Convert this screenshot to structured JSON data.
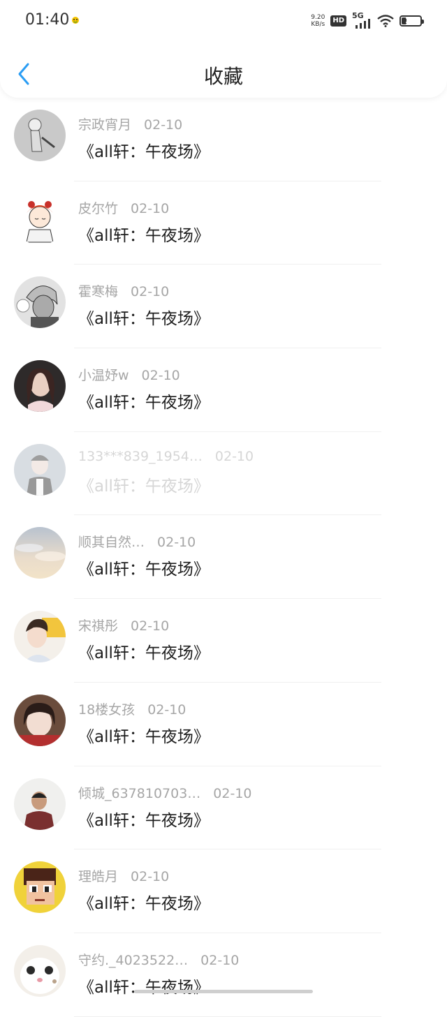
{
  "status_bar": {
    "time": "01:40",
    "speed_value": "9.20",
    "speed_unit": "KB/s",
    "hd": "HD",
    "network": "5G",
    "battery": "28",
    "battery_level": 0.28
  },
  "header": {
    "title": "收藏"
  },
  "items": [
    {
      "user": "宗政宵月",
      "date": "02-10",
      "title": "《all轩：午夜场》",
      "avatar": "sketch-figure-avatar"
    },
    {
      "user": "皮尔竹",
      "date": "02-10",
      "title": "《all轩：午夜场》",
      "avatar": "cartoon-girl-avatar"
    },
    {
      "user": "霍寒梅",
      "date": "02-10",
      "title": "《all轩：午夜场》",
      "avatar": "manga-character-avatar"
    },
    {
      "user": "小温妤w",
      "date": "02-10",
      "title": "《all轩：午夜场》",
      "avatar": "girl-photo-avatar"
    },
    {
      "user": "133***839_1954…",
      "date": "02-10",
      "title": "《all轩：午夜场》",
      "avatar": "boy-photo-avatar"
    },
    {
      "user": "顺其自然…",
      "date": "02-10",
      "title": "《all轩：午夜场》",
      "avatar": "sky-clouds-avatar"
    },
    {
      "user": "宋祺彤",
      "date": "02-10",
      "title": "《all轩：午夜场》",
      "avatar": "boy-portrait-avatar"
    },
    {
      "user": "18楼女孩",
      "date": "02-10",
      "title": "《all轩：午夜场》",
      "avatar": "girl-selfie-avatar"
    },
    {
      "user": "倾城_637810703…",
      "date": "02-10",
      "title": "《all轩：午夜场》",
      "avatar": "person-photo-avatar"
    },
    {
      "user": "理皓月",
      "date": "02-10",
      "title": "《all轩：午夜场》",
      "avatar": "pixel-character-avatar"
    },
    {
      "user": "守约._4023522…",
      "date": "02-10",
      "title": "《all轩：午夜场》",
      "avatar": "cat-face-avatar"
    }
  ],
  "colors": {
    "accent": "#2a9df4",
    "title_text": "#1e1e1e",
    "meta_text": "#a6a6a6"
  }
}
